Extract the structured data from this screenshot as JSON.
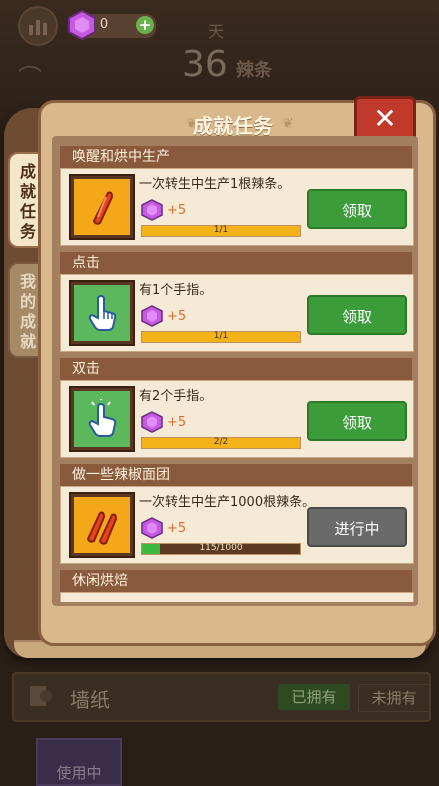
{
  "hud": {
    "gem_count": "0",
    "plus_label": "+",
    "day_label": "天",
    "stick_count": "36",
    "stick_unit": "辣条"
  },
  "modal": {
    "title": "成就任务",
    "close_label": "✕",
    "tabs": [
      {
        "label": "成就任务",
        "active": true
      },
      {
        "label": "我的成就",
        "active": false
      }
    ]
  },
  "tasks": [
    {
      "title": "唤醒和烘中生产",
      "desc": "一次转生中生产1根辣条。",
      "reward": "+5",
      "progress_text": "1/1",
      "progress": 1.0,
      "button": "领取",
      "state": "claim",
      "icon": "chili-stick-icon"
    },
    {
      "title": "点击",
      "desc": "有1个手指。",
      "reward": "+5",
      "progress_text": "1/1",
      "progress": 1.0,
      "button": "领取",
      "state": "claim",
      "icon": "pointing-hand-icon"
    },
    {
      "title": "双击",
      "desc": "有2个手指。",
      "reward": "+5",
      "progress_text": "2/2",
      "progress": 1.0,
      "button": "领取",
      "state": "claim",
      "icon": "double-tap-hand-icon"
    },
    {
      "title": "做一些辣椒面团",
      "desc": "一次转生中生产1000根辣条。",
      "reward": "+5",
      "progress_text": "115/1000",
      "progress": 0.115,
      "button": "进行中",
      "state": "in_progress",
      "icon": "double-chili-stick-icon"
    },
    {
      "title": "休闲烘焙"
    }
  ],
  "wallpaper": {
    "label": "墙纸",
    "owned": "已拥有",
    "not_owned": "未拥有",
    "in_use": "使用中"
  },
  "colors": {
    "accent_green": "#3d9c3a",
    "progress_yellow": "#f2b218",
    "progress_green": "#3cb83c",
    "close_red": "#c0392b",
    "gem_purple": "#b84dd8"
  }
}
